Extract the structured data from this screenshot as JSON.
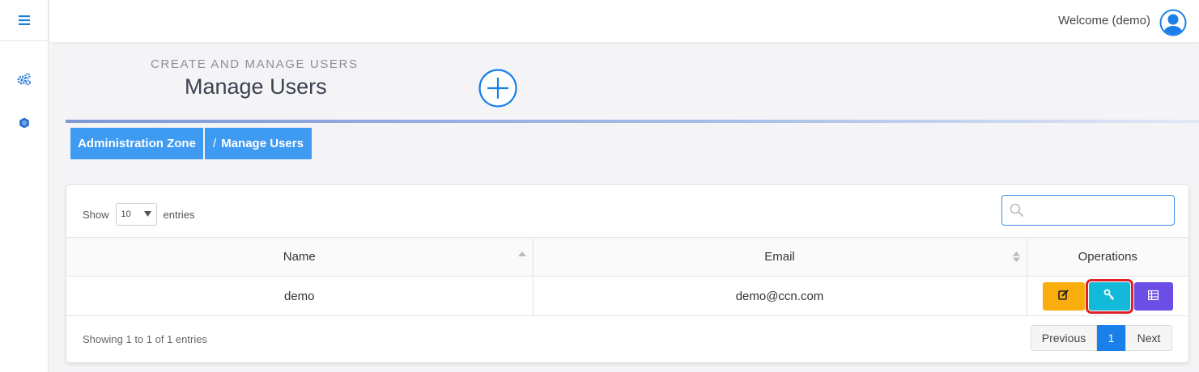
{
  "topbar": {
    "welcome_text": "Welcome (demo)"
  },
  "sidebar": {
    "items": [
      {
        "icon": "cogs-icon"
      },
      {
        "icon": "hexagon-icon"
      }
    ]
  },
  "header": {
    "subtitle": "CREATE AND MANAGE USERS",
    "title": "Manage Users"
  },
  "breadcrumb": {
    "items": [
      {
        "label": "Administration Zone"
      },
      {
        "separator": "/",
        "label": "Manage Users"
      }
    ]
  },
  "table_controls": {
    "show_label": "Show",
    "entries_value": "10",
    "entries_label": "entries",
    "search_value": ""
  },
  "table": {
    "columns": [
      "Name",
      "Email",
      "Operations"
    ],
    "rows": [
      {
        "name": "demo",
        "email": "demo@ccn.com"
      }
    ]
  },
  "footer": {
    "info": "Showing 1 to 1 of 1 entries",
    "pagination": {
      "previous": "Previous",
      "page": "1",
      "next": "Next"
    }
  },
  "colors": {
    "accent": "#3f9af2",
    "edit": "#f9ae0d",
    "key": "#13b9d8",
    "list": "#6c4de6",
    "highlight": "#e01f26"
  }
}
